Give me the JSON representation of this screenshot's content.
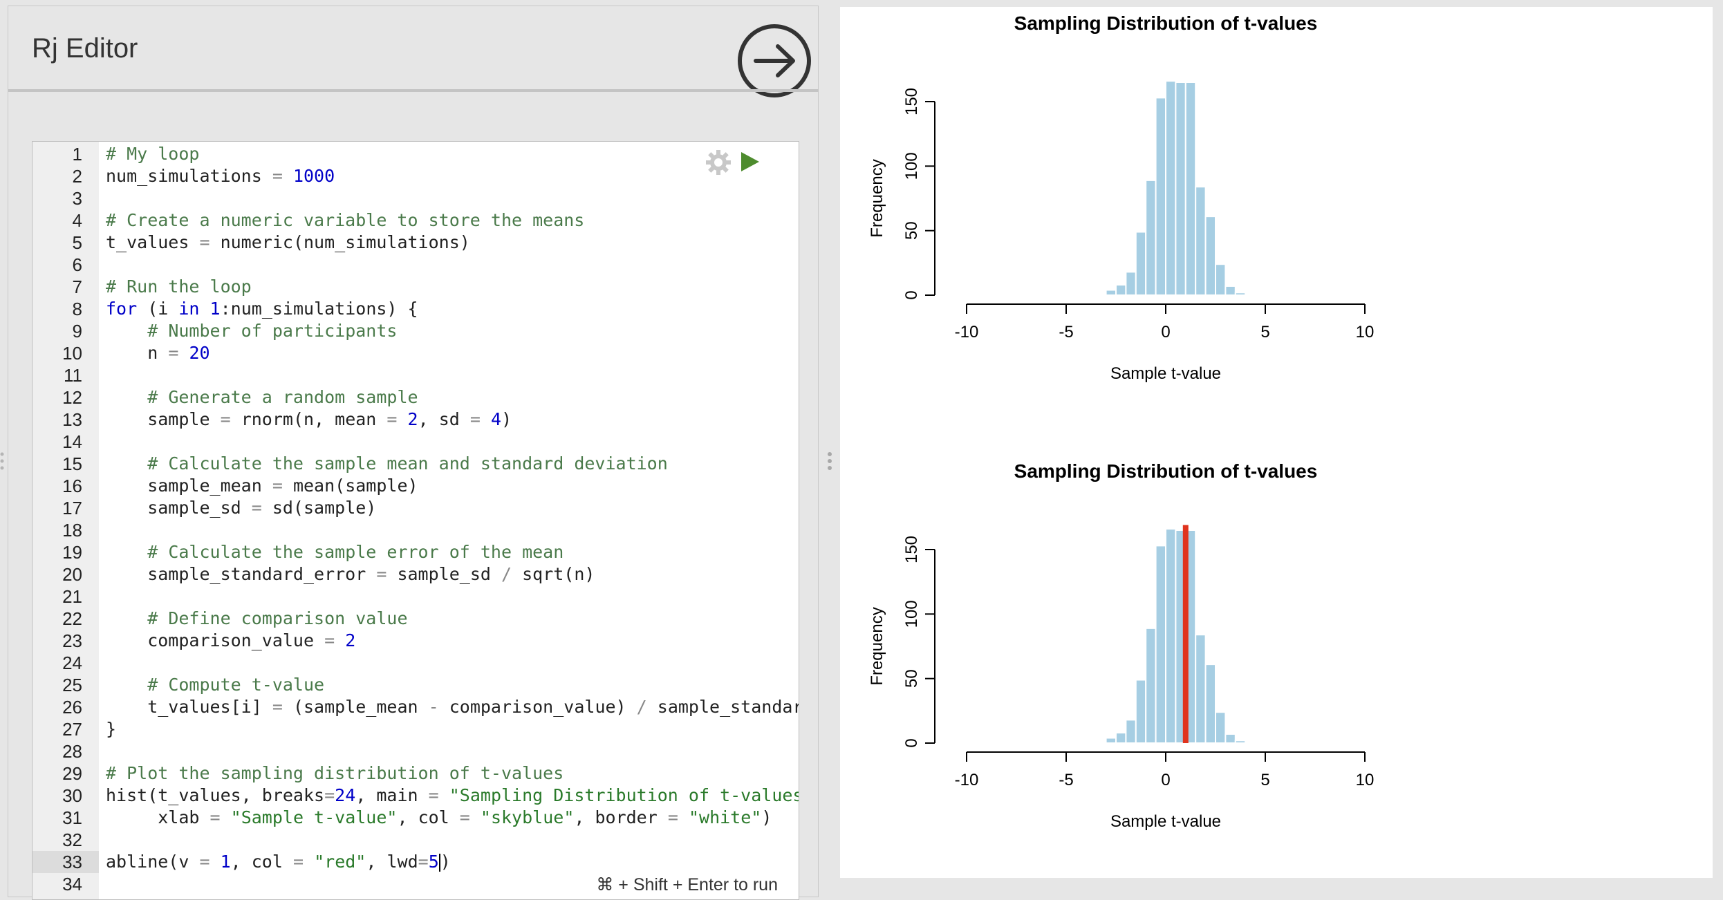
{
  "editor": {
    "title": "Rj Editor",
    "run_hint": "⌘ + Shift + Enter to run",
    "active_line": 33,
    "lines": [
      [
        [
          "cm",
          "# My loop"
        ]
      ],
      [
        [
          "t",
          "num_simulations "
        ],
        [
          "op",
          "="
        ],
        [
          "t",
          " "
        ],
        [
          "num",
          "1000"
        ]
      ],
      [],
      [
        [
          "cm",
          "# Create a numeric variable to store the means"
        ]
      ],
      [
        [
          "t",
          "t_values "
        ],
        [
          "op",
          "="
        ],
        [
          "t",
          " numeric(num_simulations)"
        ]
      ],
      [],
      [
        [
          "cm",
          "# Run the loop"
        ]
      ],
      [
        [
          "kw",
          "for"
        ],
        [
          "t",
          " (i "
        ],
        [
          "kw",
          "in"
        ],
        [
          "t",
          " "
        ],
        [
          "num",
          "1"
        ],
        [
          "t",
          ":num_simulations) {"
        ]
      ],
      [
        [
          "t",
          "    "
        ],
        [
          "cm",
          "# Number of participants"
        ]
      ],
      [
        [
          "t",
          "    n "
        ],
        [
          "op",
          "="
        ],
        [
          "t",
          " "
        ],
        [
          "num",
          "20"
        ]
      ],
      [],
      [
        [
          "t",
          "    "
        ],
        [
          "cm",
          "# Generate a random sample"
        ]
      ],
      [
        [
          "t",
          "    sample "
        ],
        [
          "op",
          "="
        ],
        [
          "t",
          " rnorm(n, mean "
        ],
        [
          "op",
          "="
        ],
        [
          "t",
          " "
        ],
        [
          "num",
          "2"
        ],
        [
          "t",
          ", sd "
        ],
        [
          "op",
          "="
        ],
        [
          "t",
          " "
        ],
        [
          "num",
          "4"
        ],
        [
          "t",
          ")"
        ]
      ],
      [],
      [
        [
          "t",
          "    "
        ],
        [
          "cm",
          "# Calculate the sample mean and standard deviation"
        ]
      ],
      [
        [
          "t",
          "    sample_mean "
        ],
        [
          "op",
          "="
        ],
        [
          "t",
          " mean(sample)"
        ]
      ],
      [
        [
          "t",
          "    sample_sd "
        ],
        [
          "op",
          "="
        ],
        [
          "t",
          " sd(sample)"
        ]
      ],
      [],
      [
        [
          "t",
          "    "
        ],
        [
          "cm",
          "# Calculate the sample error of the mean"
        ]
      ],
      [
        [
          "t",
          "    sample_standard_error "
        ],
        [
          "op",
          "="
        ],
        [
          "t",
          " sample_sd "
        ],
        [
          "op",
          "/"
        ],
        [
          "t",
          " sqrt(n)"
        ]
      ],
      [],
      [
        [
          "t",
          "    "
        ],
        [
          "cm",
          "# Define comparison value"
        ]
      ],
      [
        [
          "t",
          "    comparison_value "
        ],
        [
          "op",
          "="
        ],
        [
          "t",
          " "
        ],
        [
          "num",
          "2"
        ]
      ],
      [],
      [
        [
          "t",
          "    "
        ],
        [
          "cm",
          "# Compute t-value"
        ]
      ],
      [
        [
          "t",
          "    t_values[i] "
        ],
        [
          "op",
          "="
        ],
        [
          "t",
          " (sample_mean "
        ],
        [
          "op",
          "-"
        ],
        [
          "t",
          " comparison_value) "
        ],
        [
          "op",
          "/"
        ],
        [
          "t",
          " sample_standard_e"
        ]
      ],
      [
        [
          "t",
          "}"
        ]
      ],
      [],
      [
        [
          "cm",
          "# Plot the sampling distribution of t-values"
        ]
      ],
      [
        [
          "t",
          "hist(t_values, breaks"
        ],
        [
          "op",
          "="
        ],
        [
          "num",
          "24"
        ],
        [
          "t",
          ", main "
        ],
        [
          "op",
          "="
        ],
        [
          "t",
          " "
        ],
        [
          "str",
          "\"Sampling Distribution of t-values\""
        ],
        [
          "t",
          ","
        ]
      ],
      [
        [
          "t",
          "     xlab "
        ],
        [
          "op",
          "="
        ],
        [
          "t",
          " "
        ],
        [
          "str",
          "\"Sample t-value\""
        ],
        [
          "t",
          ", col "
        ],
        [
          "op",
          "="
        ],
        [
          "t",
          " "
        ],
        [
          "str",
          "\"skyblue\""
        ],
        [
          "t",
          ", border "
        ],
        [
          "op",
          "="
        ],
        [
          "t",
          " "
        ],
        [
          "str",
          "\"white\""
        ],
        [
          "t",
          ")"
        ]
      ],
      [],
      [
        [
          "t",
          "abline(v "
        ],
        [
          "op",
          "="
        ],
        [
          "t",
          " "
        ],
        [
          "num",
          "1"
        ],
        [
          "t",
          ", col "
        ],
        [
          "op",
          "="
        ],
        [
          "t",
          " "
        ],
        [
          "str",
          "\"red\""
        ],
        [
          "t",
          ", lwd"
        ],
        [
          "op",
          "="
        ],
        [
          "num",
          "5"
        ],
        [
          "cursor",
          ""
        ],
        [
          "t",
          ")"
        ]
      ],
      []
    ]
  },
  "chart_data": [
    {
      "type": "bar",
      "title": "Sampling Distribution of t-values",
      "xlabel": "Sample t-value",
      "ylabel": "Frequency",
      "xlim": [
        -10,
        10
      ],
      "ylim": [
        0,
        170
      ],
      "xticks": [
        "-10",
        "-5",
        "0",
        "5",
        "10"
      ],
      "yticks": [
        "0",
        "50",
        "100",
        "150"
      ],
      "bar_color": "#a6cee3",
      "bin_edges": [
        -3.5,
        -3,
        -2.5,
        -2,
        -1.5,
        -1,
        -0.5,
        0,
        0.5,
        1,
        1.5,
        2,
        2.5,
        3,
        3.5,
        4
      ],
      "values": [
        1,
        4,
        8,
        18,
        49,
        89,
        153,
        166,
        165,
        165,
        84,
        61,
        24,
        7,
        2
      ]
    },
    {
      "type": "bar",
      "title": "Sampling Distribution of t-values",
      "xlabel": "Sample t-value",
      "ylabel": "Frequency",
      "xlim": [
        -10,
        10
      ],
      "ylim": [
        0,
        170
      ],
      "xticks": [
        "-10",
        "-5",
        "0",
        "5",
        "10"
      ],
      "yticks": [
        "0",
        "50",
        "100",
        "150"
      ],
      "bar_color": "#a6cee3",
      "bin_edges": [
        -3.5,
        -3,
        -2.5,
        -2,
        -1.5,
        -1,
        -0.5,
        0,
        0.5,
        1,
        1.5,
        2,
        2.5,
        3,
        3.5,
        4
      ],
      "values": [
        1,
        4,
        8,
        18,
        49,
        89,
        153,
        166,
        165,
        165,
        84,
        61,
        24,
        7,
        2
      ],
      "vline": {
        "v": 1,
        "color": "#e0341e"
      }
    }
  ]
}
